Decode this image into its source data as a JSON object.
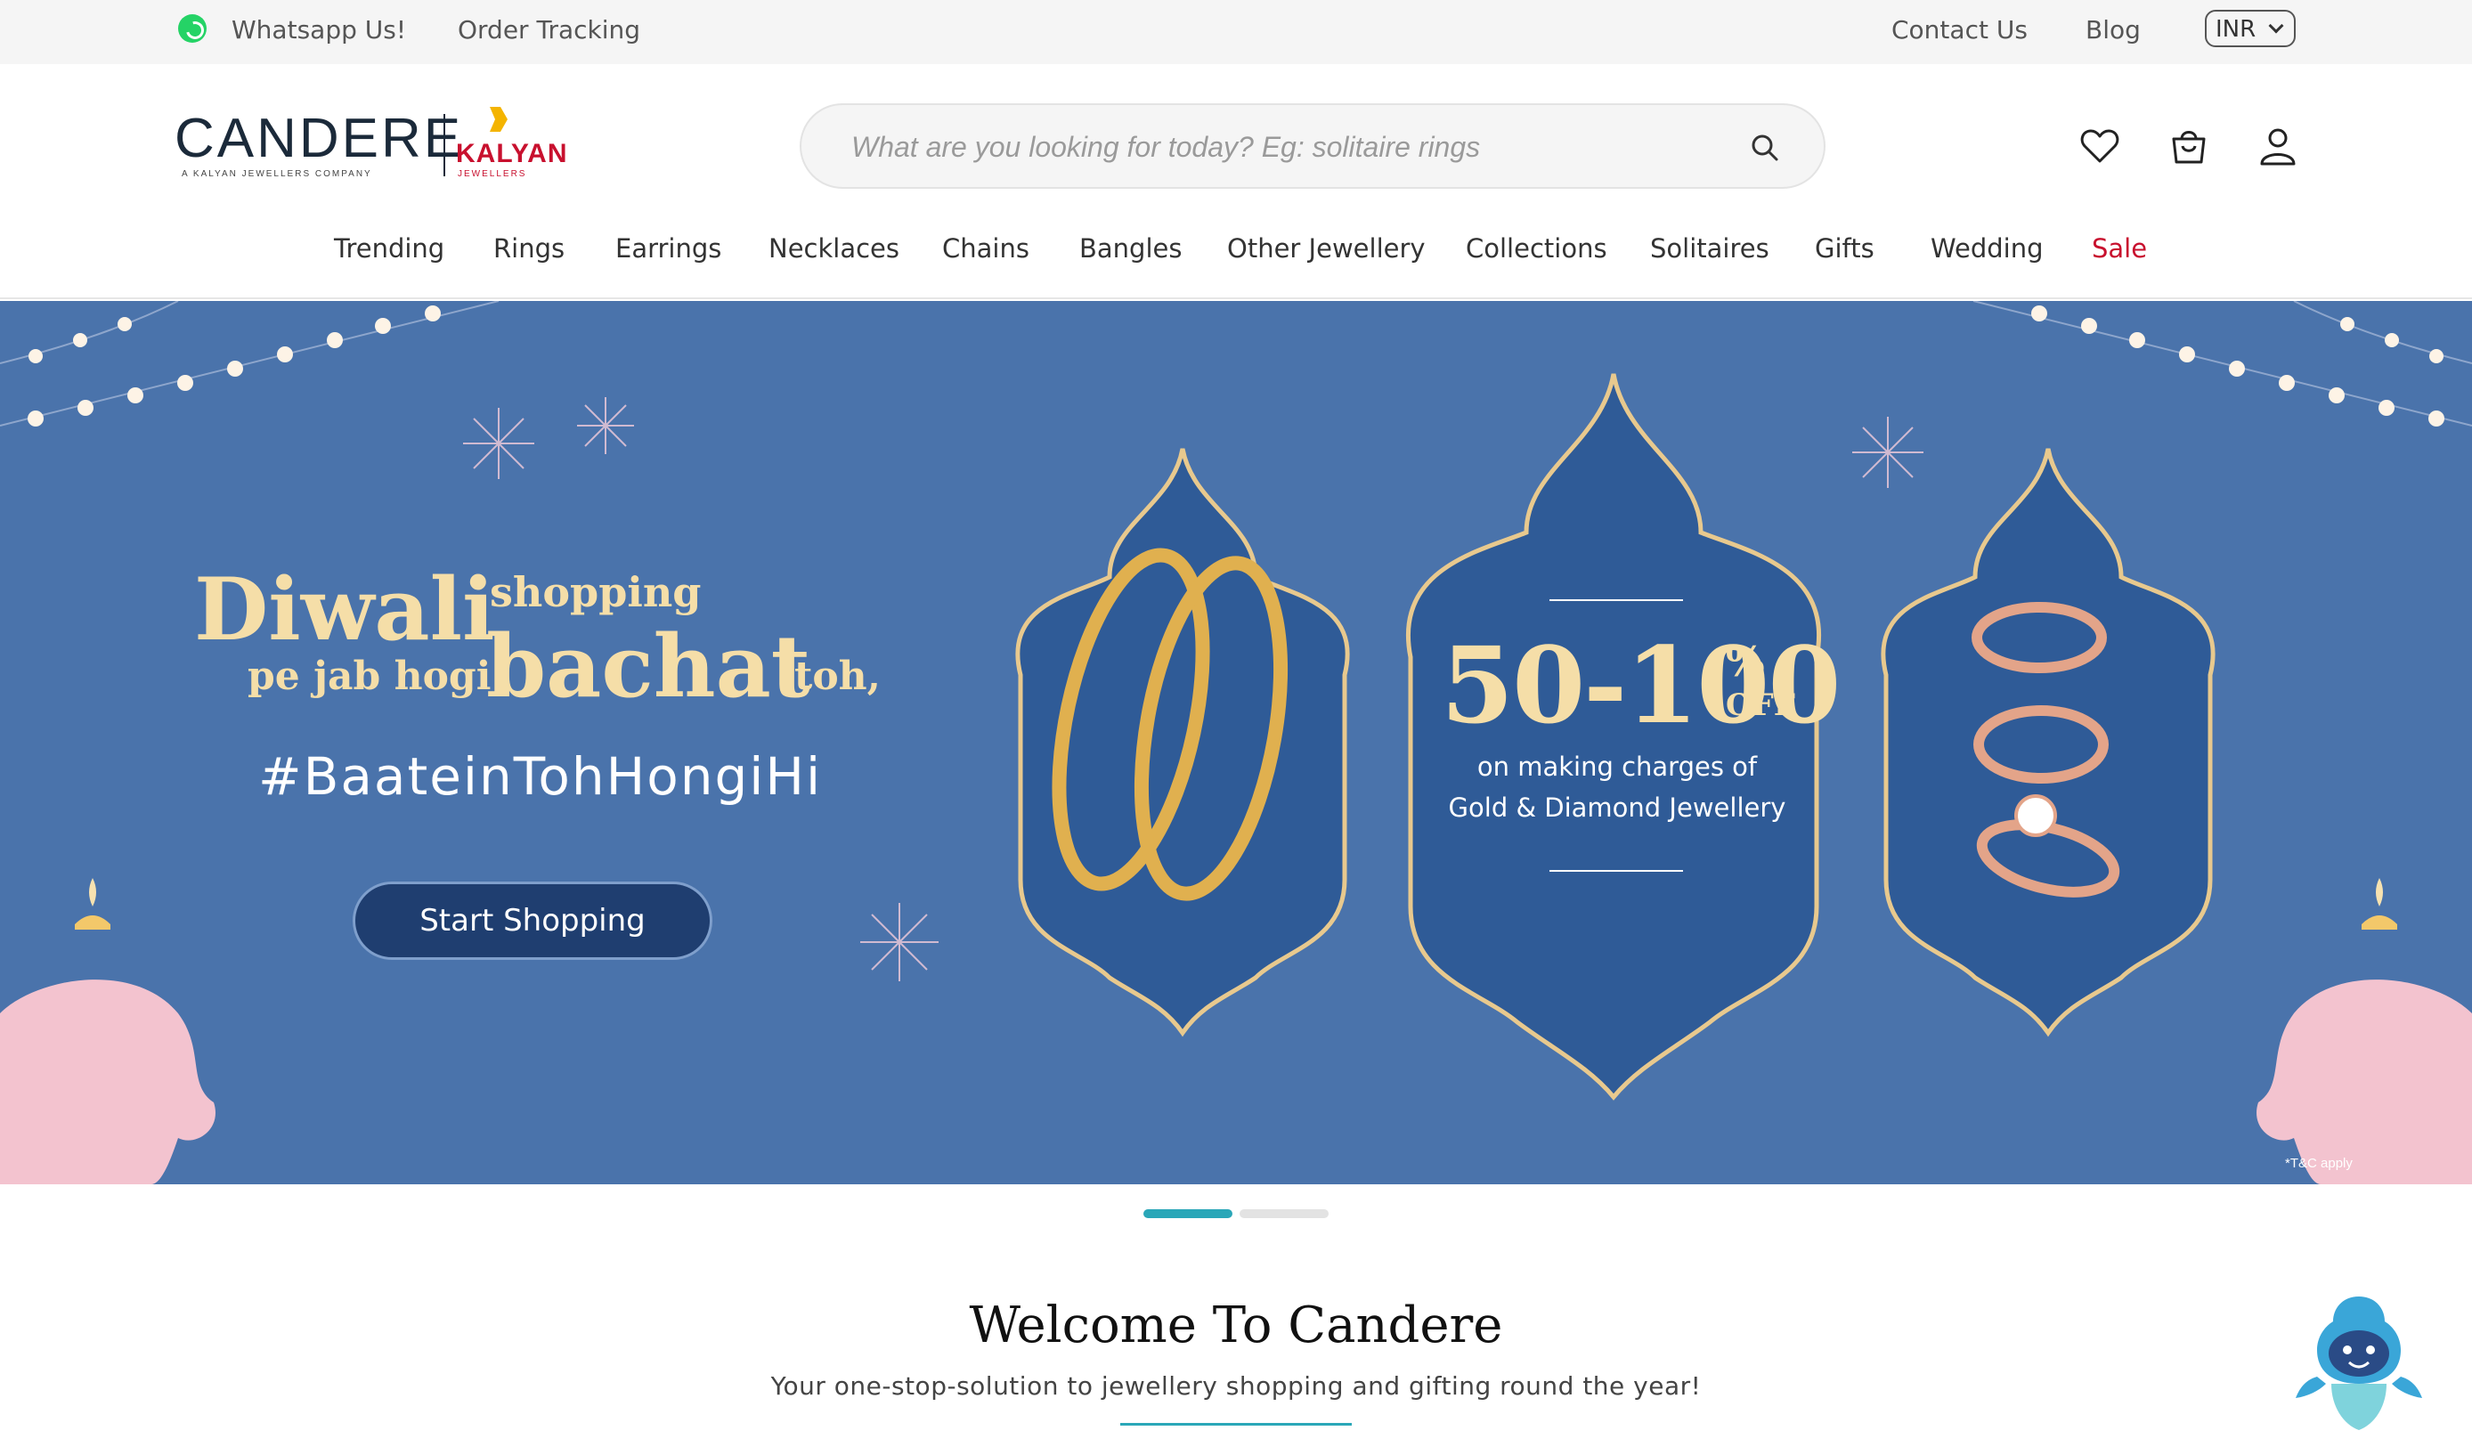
{
  "topbar": {
    "whatsapp_label": "Whatsapp Us!",
    "order_tracking_label": "Order Tracking",
    "contact_label": "Contact Us",
    "blog_label": "Blog",
    "currency_selected": "INR"
  },
  "header": {
    "logo_brand": "CANDERE",
    "logo_tagline": "A KALYAN JEWELLERS COMPANY",
    "logo_partner": "KALYAN",
    "logo_partner_sub": "JEWELLERS",
    "search_placeholder": "What are you looking for today? Eg: solitaire rings",
    "icons": [
      "heart-icon",
      "shopping-bag-icon",
      "user-icon"
    ]
  },
  "nav": {
    "items": [
      "Trending",
      "Rings",
      "Earrings",
      "Necklaces",
      "Chains",
      "Bangles",
      "Other Jewellery",
      "Collections",
      "Solitaires",
      "Gifts",
      "Wedding",
      "Sale"
    ]
  },
  "hero": {
    "line1_big": "Diwali",
    "line1_small": "shopping",
    "line2_small": "pe jab hogi",
    "line2_big": "bachat",
    "line2_end": "toh,",
    "hashtag": "#BaateinTohHongiHi",
    "cta": "Start Shopping",
    "offer_value": "50-100",
    "offer_percent": "%",
    "offer_off": "OFF",
    "offer_line1": "on making charges of",
    "offer_line2": "Gold & Diamond Jewellery",
    "disclaimer": "*T&C apply"
  },
  "carousel": {
    "slides": 2,
    "active": 1
  },
  "welcome": {
    "title": "Welcome To Candere",
    "subtitle": "Your one-stop-solution to jewellery shopping and gifting round the year!"
  },
  "colors": {
    "accent": "#2aa7b8",
    "hero_bg": "#4a73ab",
    "sale": "#c8102e",
    "gold_text": "#f5dea8"
  }
}
